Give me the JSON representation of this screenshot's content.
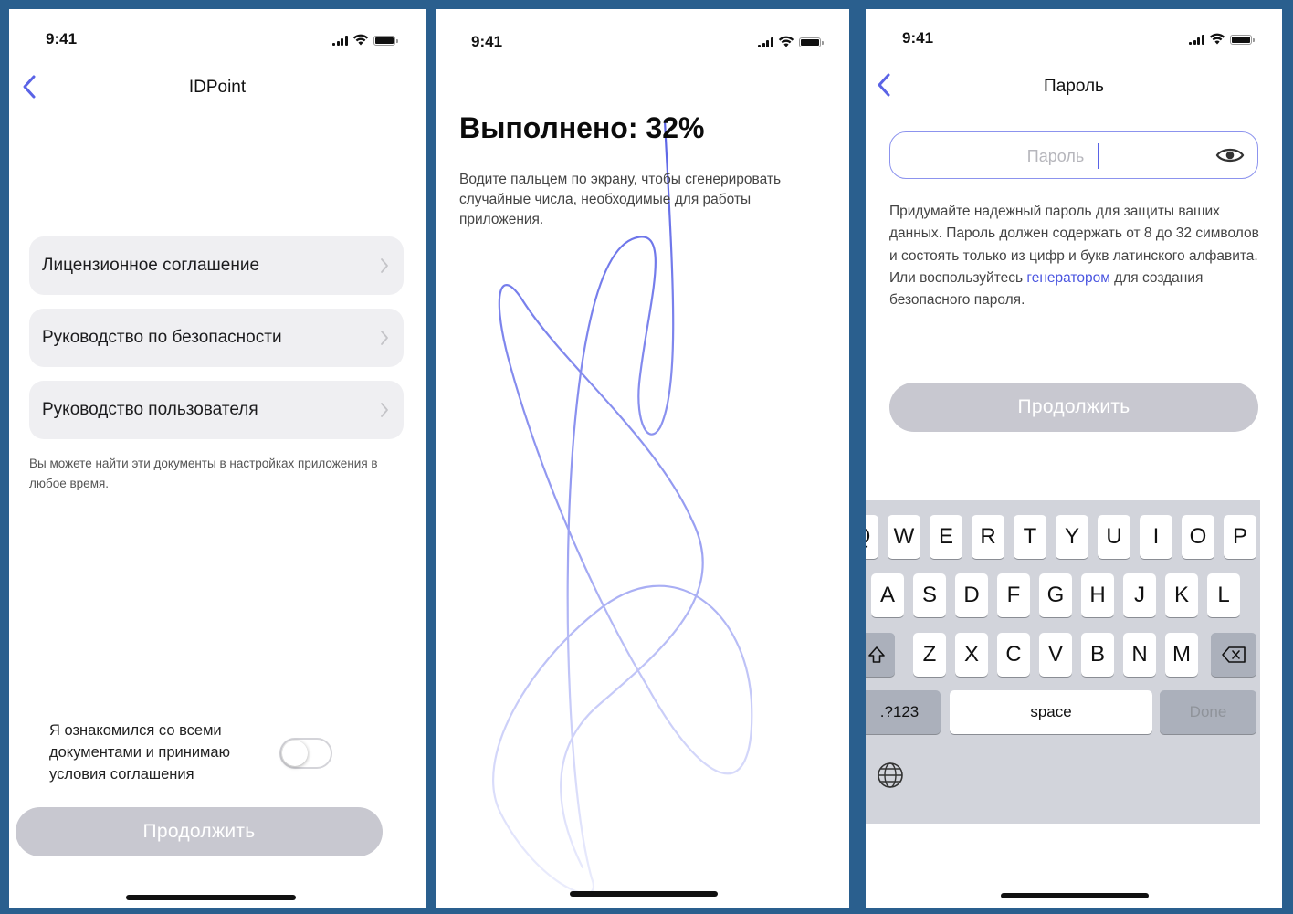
{
  "screen1": {
    "time": "9:41",
    "title": "IDPoint",
    "rows": [
      {
        "label": "Лицензионное соглашение"
      },
      {
        "label": "Руководство по безопасности"
      },
      {
        "label": "Руководство пользователя"
      }
    ],
    "hint": "Вы можете найти эти документы в настройках приложения в любое время.",
    "agree": "Я ознакомился со всеми документами и принимаю условия соглашения",
    "toggle_on": false,
    "continue": "Продолжить"
  },
  "screen2": {
    "time": "9:41",
    "progress_title": "Выполнено: 32%",
    "progress_percent": 32,
    "instruction": "Водите пальцем по экрану, чтобы сгенерировать случайные числа, необходимые для работы приложения."
  },
  "screen3": {
    "time": "9:41",
    "title": "Пароль",
    "password_placeholder": "Пароль",
    "password_value": "",
    "help_before": "Придумайте надежный пароль для защиты ваших данных. Пароль должен содержать от 8 до 32 символов и состоять только из цифр и букв латинского алфавита. Или воспользуйтесь ",
    "help_link": "генератором",
    "help_after": " для создания безопасного пароля.",
    "continue": "Продолжить",
    "keyboard": {
      "row1": [
        "Q",
        "W",
        "E",
        "R",
        "T",
        "Y",
        "U",
        "I",
        "O",
        "P"
      ],
      "row2": [
        "A",
        "S",
        "D",
        "F",
        "G",
        "H",
        "J",
        "K",
        "L"
      ],
      "row3": [
        "Z",
        "X",
        "C",
        "V",
        "B",
        "N",
        "M"
      ],
      "numbers": ".?123",
      "space": "space",
      "done": "Done"
    }
  },
  "colors": {
    "frame": "#2a5f8e",
    "accent": "#5a63e6",
    "disabled_button": "#c8c8d0",
    "row_bg": "#efeff2"
  },
  "icons": [
    "back-chevron-icon",
    "chevron-right-icon",
    "signal-icon",
    "wifi-icon",
    "battery-icon",
    "eye-icon",
    "shift-icon",
    "backspace-icon",
    "globe-icon"
  ]
}
